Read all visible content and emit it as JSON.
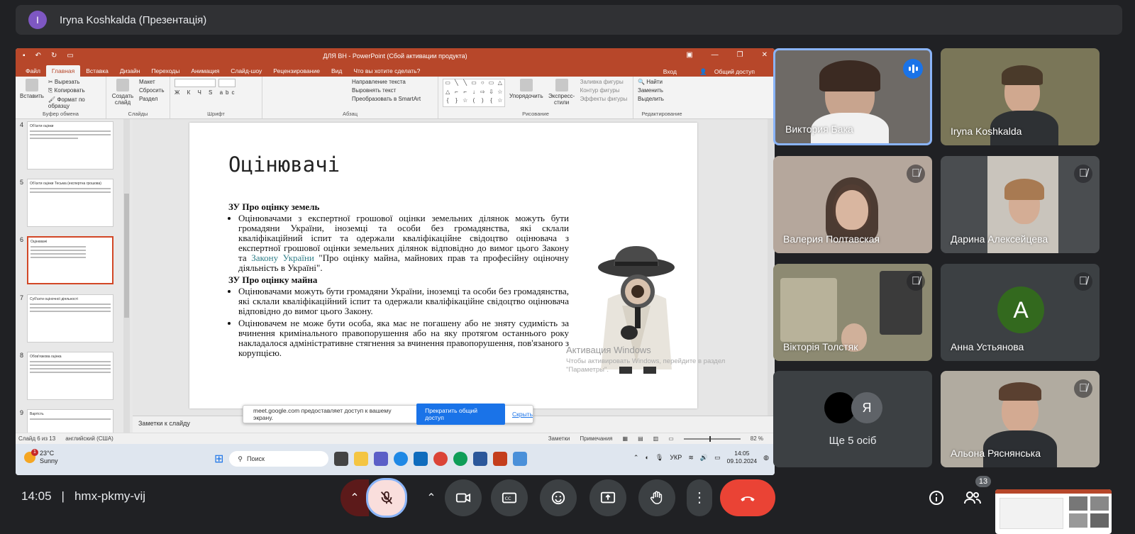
{
  "meet": {
    "presenter_initial": "I",
    "presenter_title": "Iryna Koshkalda (Презентація)",
    "time": "14:05",
    "separator": "|",
    "meeting_code": "hmx-pkmy-vij",
    "people_count": "13"
  },
  "ppt": {
    "window_title": "ДЛЯ ВН - PowerPoint (Сбой активации продукта)",
    "tabs": [
      "Файл",
      "Главная",
      "Вставка",
      "Дизайн",
      "Переходы",
      "Анимация",
      "Слайд-шоу",
      "Рецензирование",
      "Вид",
      "Что вы хотите сделать?"
    ],
    "active_tab": 1,
    "signin": "Вход",
    "share": "Общий доступ",
    "ribbon": {
      "paste": "Вставить",
      "cut": "Вырезать",
      "copy": "Копировать",
      "format_painter": "Формат по образцу",
      "clipboard_group": "Буфер обмена",
      "new_slide": "Создать слайд",
      "layout": "Макет",
      "reset": "Сбросить",
      "section": "Раздел",
      "slides_group": "Слайды",
      "font_group": "Шрифт",
      "text_direction": "Направление текста",
      "align_text": "Выровнять текст",
      "smartart": "Преобразовать в SmartArt",
      "paragraph_group": "Абзац",
      "arrange": "Упорядочить",
      "quick_styles": "Экспресс-стили",
      "shape_fill": "Заливка фигуры",
      "shape_outline": "Контур фигуры",
      "shape_effects": "Эффекты фигуры",
      "drawing_group": "Рисование",
      "find": "Найти",
      "replace": "Заменить",
      "select": "Выделить",
      "editing_group": "Редактирование"
    },
    "thumbs": [
      {
        "num": "4",
        "title": "Об'єкти оцінки"
      },
      {
        "num": "5",
        "title": "Об'єкти оцінки Тесьма (експертна грошова)"
      },
      {
        "num": "6",
        "title": "Оцінювачі"
      },
      {
        "num": "7",
        "title": "Суб'єкти оціночної діяльності"
      },
      {
        "num": "8",
        "title": "Обов'язкова оцінка"
      },
      {
        "num": "9",
        "title": "Вартість"
      }
    ],
    "slide": {
      "title": "Оцінювачі",
      "heading1": "ЗУ Про оцінку земель",
      "bullet1_a": "Оцінювачами з експертної грошової оцінки земельних ділянок можуть бути громадяни України, іноземці та особи без громадянства, які склали кваліфікаційний іспит та одержали кваліфікаційне свідоцтво оцінювача з експертної грошової оцінки земельних ділянок відповідно до вимог цього Закону та ",
      "bullet1_link": "Закону України",
      "bullet1_b": " \"Про оцінку майна, майнових прав та професійну оціночну діяльність в Україні\".",
      "heading2": "ЗУ Про оцінку майна",
      "bullet2": "Оцінювачами можуть бути громадяни України, іноземці та особи без громадянства, які склали кваліфікаційний іспит та одержали кваліфікаційне свідоцтво оцінювача відповідно до вимог цього Закону.",
      "bullet3": "Оцінювачем не може бути особа, яка має не погашену або не зняту судимість за вчинення кримінального правопорушення або на яку протягом останнього року накладалося адміністративне стягнення за вчинення правопорушення, пов'язаного з корупцією."
    },
    "notes_placeholder": "Заметки к слайду",
    "status_slide": "Слайд 6 из 13",
    "status_lang": "английский (США)",
    "status_notes": "Заметки",
    "status_comments": "Примечания",
    "zoom": "82 %",
    "watermark_title": "Активация Windows",
    "watermark_text": "Чтобы активировать Windows, перейдите в раздел \"Параметры\".",
    "share_banner": {
      "text": "meet.google.com предоставляет доступ к вашему экрану.",
      "stop": "Прекратить общий доступ",
      "hide": "Скрыть"
    }
  },
  "taskbar": {
    "weather_temp": "23°C",
    "weather_desc": "Sunny",
    "weather_badge": "1",
    "search": "Поиск",
    "lang": "УКР",
    "time": "14:05",
    "date": "09.10.2024"
  },
  "participants": [
    {
      "name": "Виктория Бака",
      "state": "speaking"
    },
    {
      "name": "Iryna Koshkalda",
      "state": "on"
    },
    {
      "name": "Валерия Полтавская",
      "state": "muted"
    },
    {
      "name": "Дарина Алексейцева",
      "state": "muted"
    },
    {
      "name": "Вікторія Толстяк",
      "state": "muted"
    },
    {
      "name": "Анна Устьянова",
      "state": "muted",
      "initial": "А"
    },
    {
      "name": "Ще 5 осіб",
      "state": "group",
      "initial": "Я"
    },
    {
      "name": "Альона Ряснянська",
      "state": "muted"
    }
  ],
  "colors": {
    "ppt_accent": "#b7472a",
    "meet_bg": "#202124",
    "tile_bg": "#3c4043",
    "end_call": "#ea4335",
    "speaking_blue": "#1a73e8"
  }
}
